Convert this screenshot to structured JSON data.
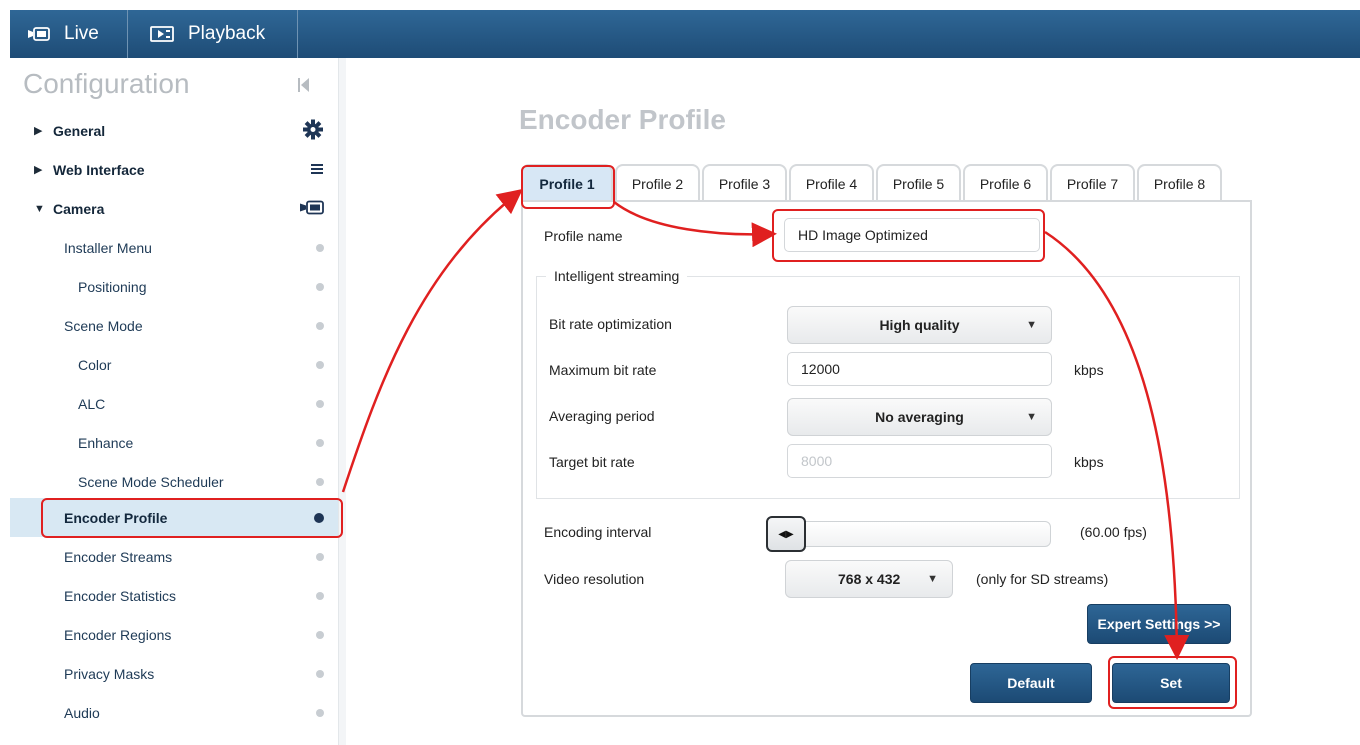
{
  "topbar": {
    "live_label": "Live",
    "playback_label": "Playback",
    "bg_color": "#1e4c76"
  },
  "sidebar": {
    "title": "Configuration",
    "items": [
      {
        "label": "General",
        "level": 0,
        "caret": "▶",
        "end": "gear-icon"
      },
      {
        "label": "Web Interface",
        "level": 0,
        "caret": "▶",
        "end": "menu-icon"
      },
      {
        "label": "Camera",
        "level": 0,
        "caret": "▼",
        "end": "camera-icon"
      },
      {
        "label": "Installer Menu",
        "level": 1
      },
      {
        "label": "Positioning",
        "level": 2
      },
      {
        "label": "Scene Mode",
        "level": 1
      },
      {
        "label": "Color",
        "level": 2
      },
      {
        "label": "ALC",
        "level": 2
      },
      {
        "label": "Enhance",
        "level": 2
      },
      {
        "label": "Scene Mode Scheduler",
        "level": 2
      },
      {
        "label": "Encoder Profile",
        "level": 1,
        "active": true
      },
      {
        "label": "Encoder Streams",
        "level": 1
      },
      {
        "label": "Encoder Statistics",
        "level": 1
      },
      {
        "label": "Encoder Regions",
        "level": 1
      },
      {
        "label": "Privacy Masks",
        "level": 1
      },
      {
        "label": "Audio",
        "level": 1
      }
    ]
  },
  "main": {
    "title": "Encoder Profile",
    "tabs": [
      "Profile 1",
      "Profile 2",
      "Profile 3",
      "Profile 4",
      "Profile 5",
      "Profile 6",
      "Profile 7",
      "Profile 8"
    ],
    "active_tab": "Profile 1",
    "profile_name_label": "Profile name",
    "profile_name_value": "HD Image Optimized",
    "intelligent_streaming_label": "Intelligent streaming",
    "bitrate_optimization_label": "Bit rate optimization",
    "bitrate_optimization_value": "High quality",
    "max_bitrate_label": "Maximum bit rate",
    "max_bitrate_value": "12000",
    "max_bitrate_unit": "kbps",
    "averaging_period_label": "Averaging period",
    "averaging_period_value": "No averaging",
    "target_bitrate_label": "Target bit rate",
    "target_bitrate_value": "8000",
    "target_bitrate_unit": "kbps",
    "encoding_interval_label": "Encoding interval",
    "encoding_interval_value": "(60.00 fps)",
    "encoding_interval_level": 0,
    "video_resolution_label": "Video resolution",
    "video_resolution_value": "768 x 432",
    "video_resolution_note": "(only for SD streams)",
    "expert_settings_label": "Expert Settings >>",
    "default_label": "Default",
    "set_label": "Set",
    "accent_color": "#1e4c76",
    "annotation_color": "#e02020"
  }
}
